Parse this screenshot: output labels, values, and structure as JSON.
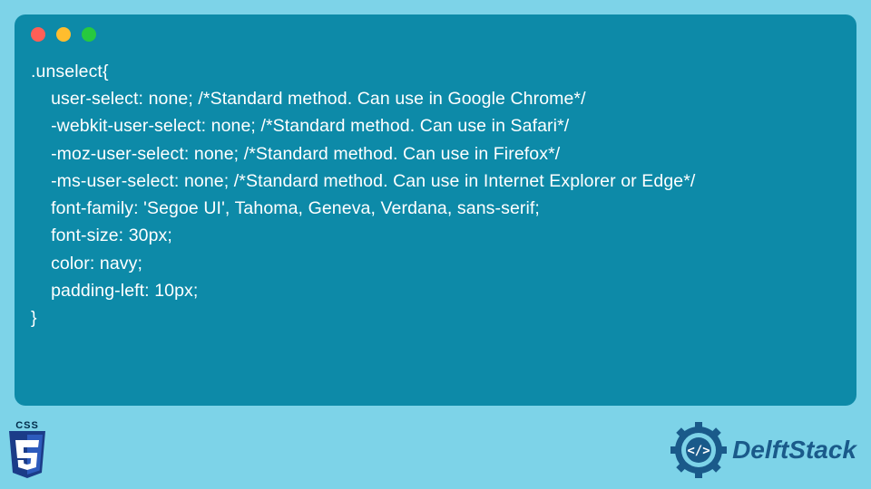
{
  "code": {
    "l1": ".unselect{",
    "l2": "    user-select: none; /*Standard method. Can use in Google Chrome*/",
    "l3": "    -webkit-user-select: none; /*Standard method. Can use in Safari*/",
    "l4": "    -moz-user-select: none; /*Standard method. Can use in Firefox*/",
    "l5": "    -ms-user-select: none; /*Standard method. Can use in Internet Explorer or Edge*/",
    "blank": "",
    "l6": "    font-family: 'Segoe UI', Tahoma, Geneva, Verdana, sans-serif;",
    "l7": "    font-size: 30px;",
    "l8": "    color: navy;",
    "l9": "    padding-left: 10px;",
    "l10": "}"
  },
  "footer": {
    "css_label": "CSS",
    "brand": "DelftStack"
  }
}
